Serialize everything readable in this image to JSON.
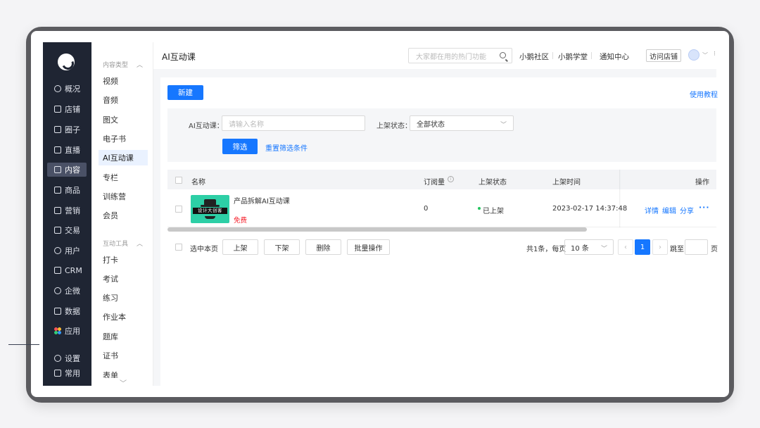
{
  "nav": {
    "items": [
      {
        "label": "概况",
        "icon": "pie-chart-icon"
      },
      {
        "label": "店铺",
        "icon": "store-icon"
      },
      {
        "label": "圈子",
        "icon": "community-icon"
      },
      {
        "label": "直播",
        "icon": "live-icon"
      },
      {
        "label": "内容",
        "icon": "content-icon"
      },
      {
        "label": "商品",
        "icon": "product-icon"
      },
      {
        "label": "营销",
        "icon": "megaphone-icon"
      },
      {
        "label": "交易",
        "icon": "trade-icon"
      },
      {
        "label": "用户",
        "icon": "user-icon"
      },
      {
        "label": "CRM",
        "icon": "crm-icon"
      },
      {
        "label": "企微",
        "icon": "wecom-icon"
      },
      {
        "label": "数据",
        "icon": "data-icon"
      },
      {
        "label": "应用",
        "icon": "apps-icon"
      },
      {
        "label": "设置",
        "icon": "settings-icon"
      },
      {
        "label": "常用",
        "icon": "favorites-icon"
      }
    ],
    "active_index": 4
  },
  "submenu": {
    "group1": "内容类型",
    "group1_items": [
      "视频",
      "音频",
      "图文",
      "电子书",
      "AI互动课",
      "专栏",
      "训练营",
      "会员"
    ],
    "active": "AI互动课",
    "group2": "互动工具",
    "group2_items": [
      "打卡",
      "考试",
      "练习",
      "作业本",
      "题库",
      "证书",
      "表单"
    ]
  },
  "topbar": {
    "title": "AI互动课",
    "search_placeholder": "大家都在用的热门功能",
    "links": [
      "小鹅社区",
      "小鹅学堂",
      "通知中心"
    ],
    "visit_store": "访问店铺"
  },
  "toolbar": {
    "new_label": "新建",
    "tutorial_label": "使用教程"
  },
  "filter": {
    "name_label": "AI互动课：",
    "name_placeholder": "请输入名称",
    "status_label": "上架状态：",
    "status_value": "全部状态",
    "filter_button": "筛选",
    "reset_link": "重置筛选条件"
  },
  "table": {
    "columns": [
      "名称",
      "订阅量",
      "上架状态",
      "上架时间",
      "操作"
    ],
    "rows": [
      {
        "thumb_text": "设计大创客",
        "name": "产品拆解AI互动课",
        "price": "免费",
        "subscriptions": "0",
        "status": "已上架",
        "time": "2023-02-17 14:37:48",
        "actions": [
          "详情",
          "编辑",
          "分享"
        ]
      }
    ]
  },
  "bulk": {
    "select_page": "选中本页",
    "buttons": [
      "上架",
      "下架",
      "删除",
      "批量操作"
    ]
  },
  "pagination": {
    "total": "共1条，每页",
    "page_size": "10 条",
    "current": "1",
    "jump_label": "跳至",
    "page_suffix": "页"
  },
  "colors": {
    "primary": "#1677ff",
    "nav_bg": "#1f2533",
    "free_red": "#f5222d",
    "status_green": "#22c55e"
  }
}
